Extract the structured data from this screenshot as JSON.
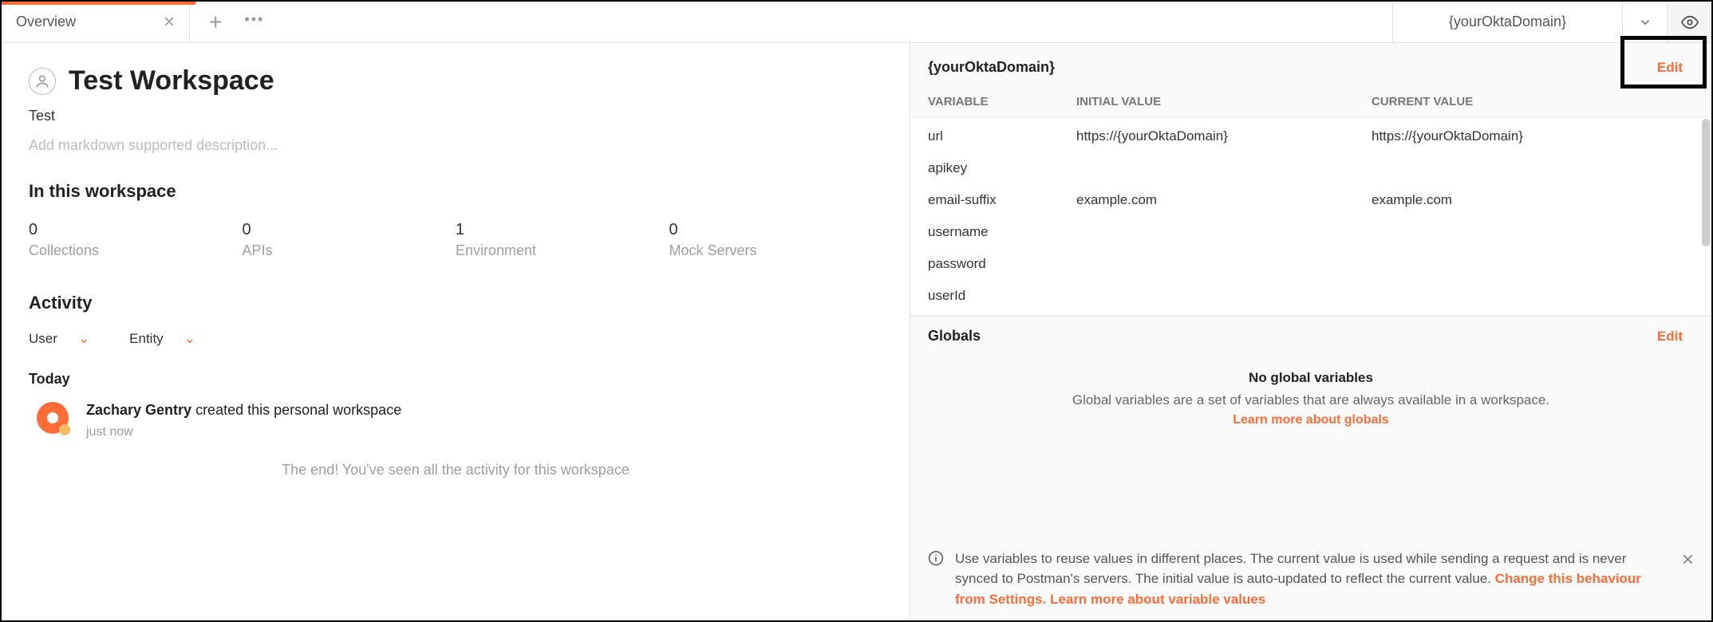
{
  "tabs": {
    "overview": "Overview"
  },
  "env": {
    "name": "{yourOktaDomain}"
  },
  "workspace": {
    "title": "Test Workspace",
    "subtitle": "Test",
    "description_placeholder": "Add markdown supported description...",
    "section_heading": "In this workspace",
    "stats": [
      {
        "value": "0",
        "label": "Collections"
      },
      {
        "value": "0",
        "label": "APIs"
      },
      {
        "value": "1",
        "label": "Environment"
      },
      {
        "value": "0",
        "label": "Mock Servers"
      }
    ]
  },
  "activity": {
    "heading": "Activity",
    "filters": {
      "user": "User",
      "entity": "Entity"
    },
    "today_label": "Today",
    "event": {
      "user": "Zachary Gentry",
      "action": " created this personal workspace",
      "time": "just now"
    },
    "end_text": "The end! You've seen all the activity for this workspace"
  },
  "panel": {
    "title": "{yourOktaDomain}",
    "edit": "Edit",
    "cols": {
      "variable": "VARIABLE",
      "initial": "INITIAL VALUE",
      "current": "CURRENT VALUE"
    },
    "rows": [
      {
        "v": "url",
        "i": "https://{yourOktaDomain}",
        "c": "https://{yourOktaDomain}"
      },
      {
        "v": "apikey",
        "i": "",
        "c": ""
      },
      {
        "v": "email-suffix",
        "i": "example.com",
        "c": "example.com"
      },
      {
        "v": "username",
        "i": "",
        "c": ""
      },
      {
        "v": "password",
        "i": "",
        "c": ""
      },
      {
        "v": "userId",
        "i": "",
        "c": ""
      }
    ]
  },
  "globals": {
    "title": "Globals",
    "edit": "Edit",
    "empty_title": "No global variables",
    "empty_desc": "Global variables are a set of variables that are always available in a workspace.",
    "learn_more": "Learn more about globals"
  },
  "info": {
    "text1": "Use variables to reuse values in different places. The current value is used while sending a request and is never synced to Postman's servers. The initial value is auto-updated to reflect the current value. ",
    "link1": "Change this behaviour from Settings.",
    "link2": " Learn more about variable values"
  }
}
